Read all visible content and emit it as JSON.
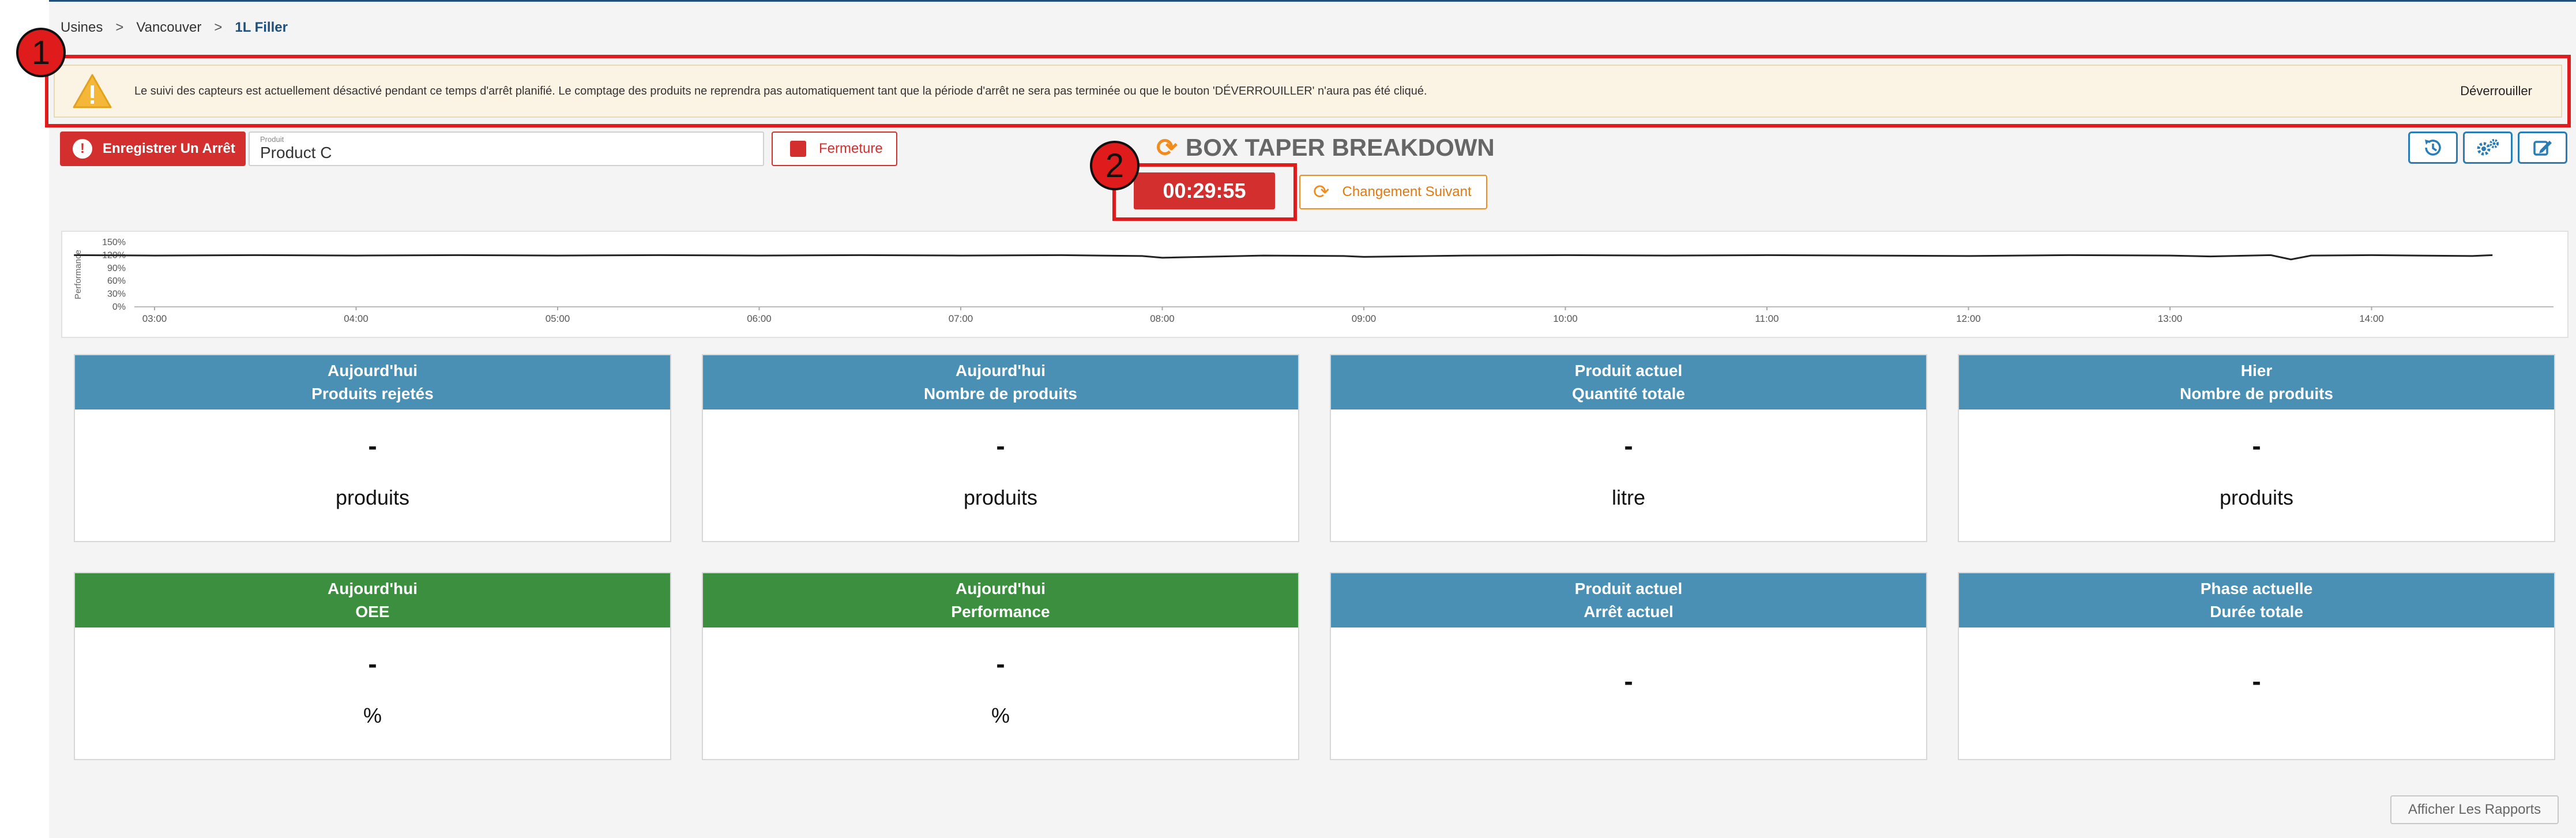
{
  "breadcrumb": {
    "items": [
      "Usines",
      "Vancouver",
      "1L Filler"
    ],
    "separator": ">"
  },
  "alert": {
    "message": "Le suivi des capteurs est actuellement désactivé pendant ce temps d'arrêt planifié. Le comptage des produits ne reprendra pas automatiquement tant que la période d'arrêt ne sera pas terminée ou que le bouton 'DÉVERROUILLER' n'aura pas été cliqué.",
    "unlock_label": "Déverrouiller",
    "icon": "warning-icon"
  },
  "annotations": {
    "badge1": "1",
    "badge2": "2"
  },
  "toolbar": {
    "stop_label": "Enregistrer Un Arrêt",
    "product_field_label": "Produit",
    "product_value": "Product C",
    "close_label": "Fermeture",
    "title": "BOX TAPER BREAKDOWN",
    "timer": "00:29:55",
    "next_label": "Changement Suivant",
    "icons": [
      "history-icon",
      "settings-icon",
      "edit-icon"
    ]
  },
  "chart_data": {
    "type": "line",
    "ylabel": "Performance",
    "yticks": [
      "150%",
      "120%",
      "90%",
      "60%",
      "30%",
      "0%"
    ],
    "ylim": [
      0,
      150
    ],
    "xticks": [
      "03:00",
      "04:00",
      "05:00",
      "06:00",
      "07:00",
      "08:00",
      "09:00",
      "10:00",
      "11:00",
      "12:00",
      "13:00",
      "14:00"
    ],
    "series": [
      {
        "values_hours": [
          2.6,
          3.0,
          3.5,
          4.0,
          4.5,
          5.0,
          5.5,
          6.0,
          6.5,
          7.0,
          7.5,
          7.9,
          8.0,
          8.5,
          8.9,
          9.0,
          9.5,
          10.0,
          10.5,
          11.0,
          11.5,
          12.0,
          12.5,
          13.0,
          13.2,
          13.5,
          13.6,
          13.7,
          14.0,
          14.5,
          14.6
        ],
        "values_percent": [
          120,
          119,
          120,
          119,
          120,
          119,
          120,
          119,
          120,
          119,
          120,
          118,
          114,
          119,
          118,
          116,
          119,
          120,
          119,
          120,
          119,
          118,
          120,
          119,
          117,
          120,
          110,
          119,
          120,
          118,
          120
        ]
      }
    ]
  },
  "cards": [
    {
      "line1": "Aujourd'hui",
      "line2": "Produits rejetés",
      "value": "-",
      "unit": "produits",
      "color": "blue"
    },
    {
      "line1": "Aujourd'hui",
      "line2": "Nombre de produits",
      "value": "-",
      "unit": "produits",
      "color": "blue"
    },
    {
      "line1": "Produit actuel",
      "line2": "Quantité totale",
      "value": "-",
      "unit": "litre",
      "color": "blue"
    },
    {
      "line1": "Hier",
      "line2": "Nombre de produits",
      "value": "-",
      "unit": "produits",
      "color": "blue"
    },
    {
      "line1": "Aujourd'hui",
      "line2": "OEE",
      "value": "-",
      "unit": "%",
      "color": "green"
    },
    {
      "line1": "Aujourd'hui",
      "line2": "Performance",
      "value": "-",
      "unit": "%",
      "color": "green"
    },
    {
      "line1": "Produit actuel",
      "line2": "Arrêt actuel",
      "value": "-",
      "unit": "",
      "color": "blue"
    },
    {
      "line1": "Phase actuelle",
      "line2": "Durée totale",
      "value": "-",
      "unit": "",
      "color": "blue"
    }
  ],
  "footer": {
    "report_label": "Afficher Les Rapports"
  },
  "colors": {
    "accent_blue": "#4a90b4",
    "green": "#3b8f3f",
    "red": "#d32f2f",
    "orange": "#f08c1e",
    "highlight_red": "#e01b1b"
  }
}
